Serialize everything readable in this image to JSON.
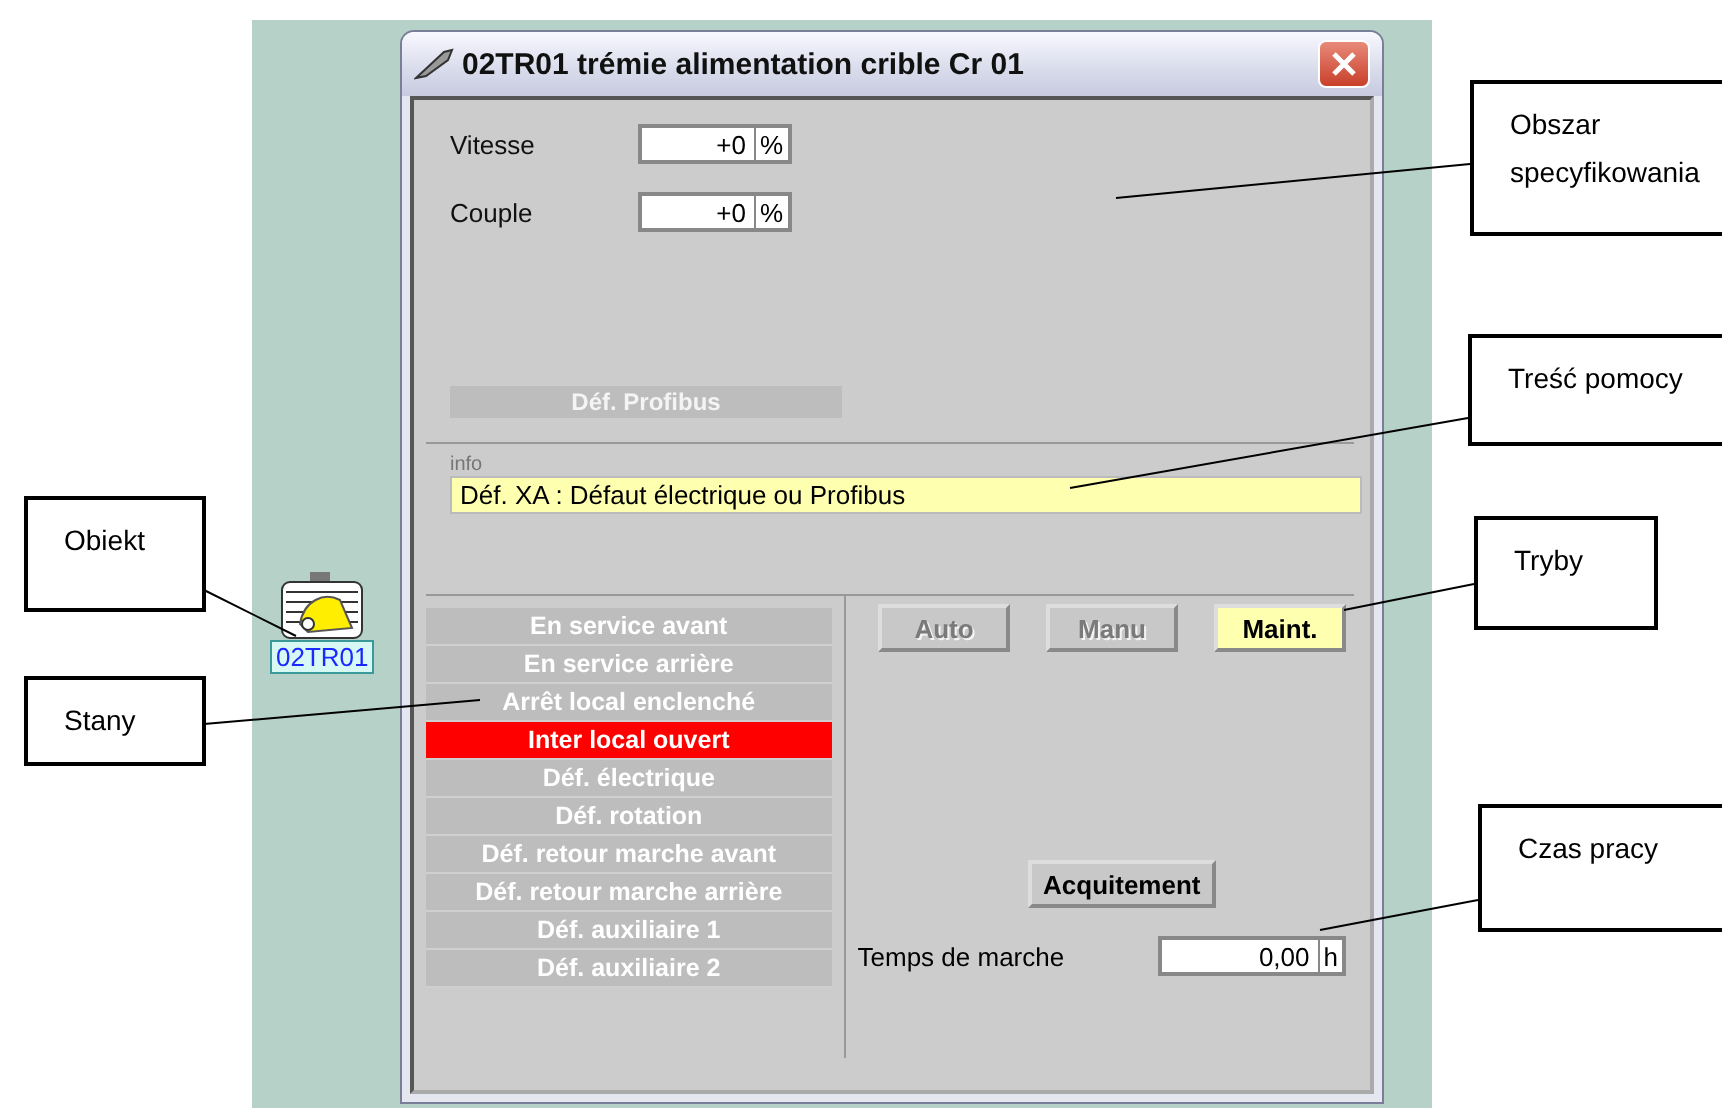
{
  "window": {
    "title": "02TR01 trémie alimentation crible Cr 01"
  },
  "fields": [
    {
      "label": "Vitesse",
      "value": "+0",
      "unit": "%"
    },
    {
      "label": "Couple",
      "value": "+0",
      "unit": "%"
    }
  ],
  "fault_bar": {
    "label": "Déf. Profibus"
  },
  "info": {
    "label": "info",
    "text": "Déf. XA : Défaut électrique ou Profibus"
  },
  "states": [
    {
      "label": "En service avant",
      "active": false
    },
    {
      "label": "En service arrière",
      "active": false
    },
    {
      "label": "Arrêt local enclenché",
      "active": false
    },
    {
      "label": "Inter local ouvert",
      "active": true
    },
    {
      "label": "Déf. électrique",
      "active": false
    },
    {
      "label": "Déf. rotation",
      "active": false
    },
    {
      "label": "Déf. retour marche avant",
      "active": false
    },
    {
      "label": "Déf. retour marche arrière",
      "active": false
    },
    {
      "label": "Déf. auxiliaire 1",
      "active": false
    },
    {
      "label": "Déf. auxiliaire 2",
      "active": false
    }
  ],
  "modes": [
    {
      "label": "Auto",
      "selected": false,
      "disabled": true
    },
    {
      "label": "Manu",
      "selected": false,
      "disabled": true
    },
    {
      "label": "Maint.",
      "selected": true,
      "disabled": false
    }
  ],
  "ack_button": {
    "label": "Acquitement"
  },
  "runtime": {
    "label": "Temps de marche",
    "value": "0,00",
    "unit": "h"
  },
  "object": {
    "label": "02TR01"
  },
  "callouts": [
    {
      "text": "Obszar specyfikowania"
    },
    {
      "text": "Treść pomocy"
    },
    {
      "text": "Tryby"
    },
    {
      "text": "Czas pracy"
    },
    {
      "text": "Obiekt"
    },
    {
      "text": "Stany"
    }
  ]
}
